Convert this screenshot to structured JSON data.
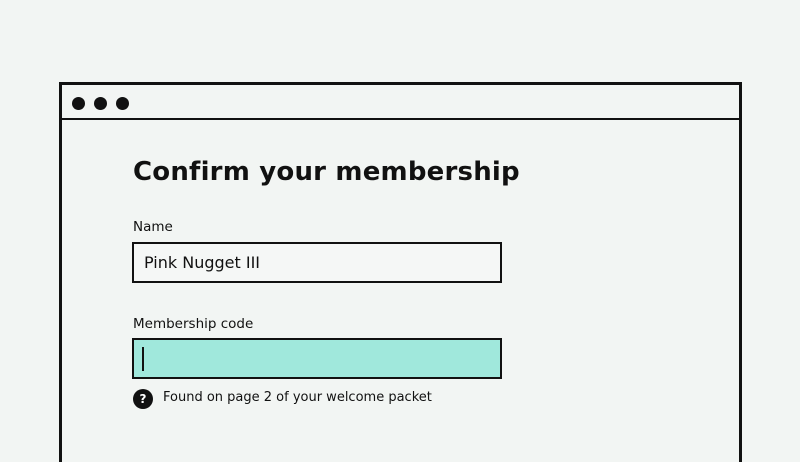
{
  "form": {
    "title": "Confirm your membership",
    "name_field": {
      "label": "Name",
      "value": "Pink Nugget III"
    },
    "membership_code_field": {
      "label": "Membership code",
      "value": "",
      "state": "focused"
    },
    "help": {
      "icon": "question-mark-icon",
      "text": "Found on page 2 of your welcome packet"
    }
  },
  "colors": {
    "background": "#f2f5f3",
    "focused_input": "#a0e8dc",
    "ink": "#111111"
  }
}
